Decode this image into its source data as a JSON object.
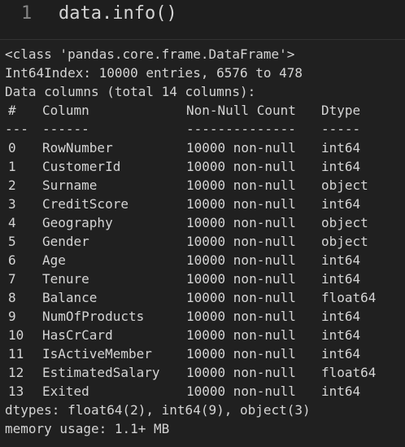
{
  "input": {
    "line_number": "1",
    "code": "data.info()"
  },
  "output": {
    "class_line": "<class 'pandas.core.frame.DataFrame'>",
    "index_line": "Int64Index: 10000 entries, 6576 to 478",
    "columns_line": "Data columns (total 14 columns):",
    "header": {
      "idx": "#",
      "column": "Column",
      "count": "Non-Null Count",
      "dtype": "Dtype"
    },
    "separator": {
      "idx": "---",
      "column": "------",
      "count": "--------------",
      "dtype": "-----"
    },
    "rows": [
      {
        "idx": "0",
        "column": "RowNumber",
        "count": "10000 non-null",
        "dtype": "int64"
      },
      {
        "idx": "1",
        "column": "CustomerId",
        "count": "10000 non-null",
        "dtype": "int64"
      },
      {
        "idx": "2",
        "column": "Surname",
        "count": "10000 non-null",
        "dtype": "object"
      },
      {
        "idx": "3",
        "column": "CreditScore",
        "count": "10000 non-null",
        "dtype": "int64"
      },
      {
        "idx": "4",
        "column": "Geography",
        "count": "10000 non-null",
        "dtype": "object"
      },
      {
        "idx": "5",
        "column": "Gender",
        "count": "10000 non-null",
        "dtype": "object"
      },
      {
        "idx": "6",
        "column": "Age",
        "count": "10000 non-null",
        "dtype": "int64"
      },
      {
        "idx": "7",
        "column": "Tenure",
        "count": "10000 non-null",
        "dtype": "int64"
      },
      {
        "idx": "8",
        "column": "Balance",
        "count": "10000 non-null",
        "dtype": "float64"
      },
      {
        "idx": "9",
        "column": "NumOfProducts",
        "count": "10000 non-null",
        "dtype": "int64"
      },
      {
        "idx": "10",
        "column": "HasCrCard",
        "count": "10000 non-null",
        "dtype": "int64"
      },
      {
        "idx": "11",
        "column": "IsActiveMember",
        "count": "10000 non-null",
        "dtype": "int64"
      },
      {
        "idx": "12",
        "column": "EstimatedSalary",
        "count": "10000 non-null",
        "dtype": "float64"
      },
      {
        "idx": "13",
        "column": "Exited",
        "count": "10000 non-null",
        "dtype": "int64"
      }
    ],
    "dtypes_line": "dtypes: float64(2), int64(9), object(3)",
    "memory_line": "memory usage: 1.1+ MB"
  }
}
